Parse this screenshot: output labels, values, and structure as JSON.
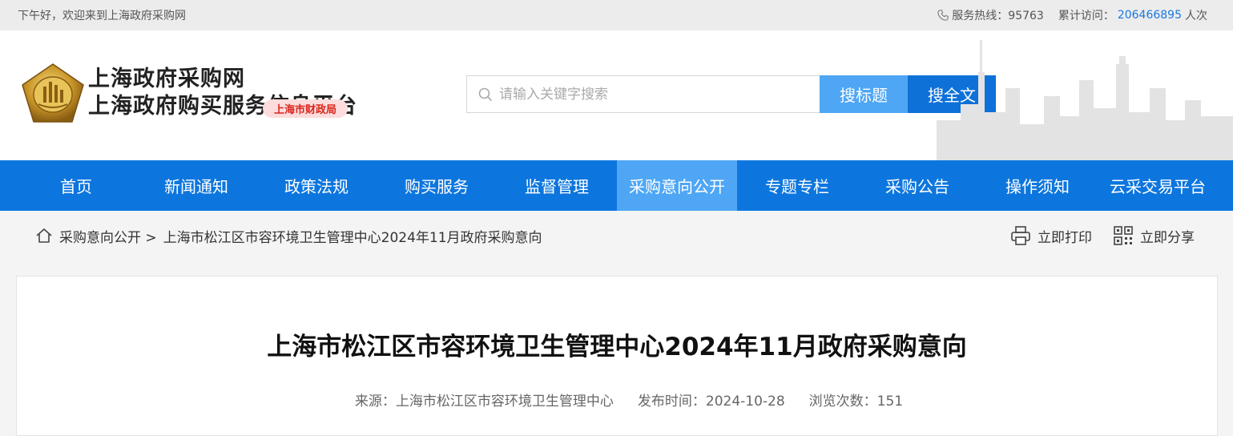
{
  "topbar": {
    "greeting": "下午好，欢迎来到上海政府采购网",
    "hotline_label": "服务热线：95763",
    "visits_label": "累计访问：",
    "visits_count": "206466895",
    "visits_unit": "人次"
  },
  "header": {
    "site_name_1": "上海政府采购网",
    "site_name_2": "上海政府购买服务信息平台",
    "badge": "上海市财政局"
  },
  "search": {
    "placeholder": "请输入关键字搜索",
    "btn_title": "搜标题",
    "btn_full": "搜全文"
  },
  "nav": {
    "items": [
      {
        "label": "首页"
      },
      {
        "label": "新闻通知"
      },
      {
        "label": "政策法规"
      },
      {
        "label": "购买服务"
      },
      {
        "label": "监督管理"
      },
      {
        "label": "采购意向公开"
      },
      {
        "label": "专题专栏"
      },
      {
        "label": "采购公告"
      },
      {
        "label": "操作须知"
      },
      {
        "label": "云采交易平台"
      }
    ],
    "active": "采购意向公开"
  },
  "breadcrumb": {
    "section": "采购意向公开 >",
    "current": "上海市松江区市容环境卫生管理中心2024年11月政府采购意向"
  },
  "actions": {
    "print": "立即打印",
    "share": "立即分享"
  },
  "article": {
    "title": "上海市松江区市容环境卫生管理中心2024年11月政府采购意向",
    "source": "来源：上海市松江区市容环境卫生管理中心",
    "published": "发布时间：2024-10-28",
    "views": "浏览次数：151"
  },
  "colors": {
    "primary": "#0d76de",
    "active_nav": "#4ea6f5",
    "badge_text": "#d9261c"
  }
}
